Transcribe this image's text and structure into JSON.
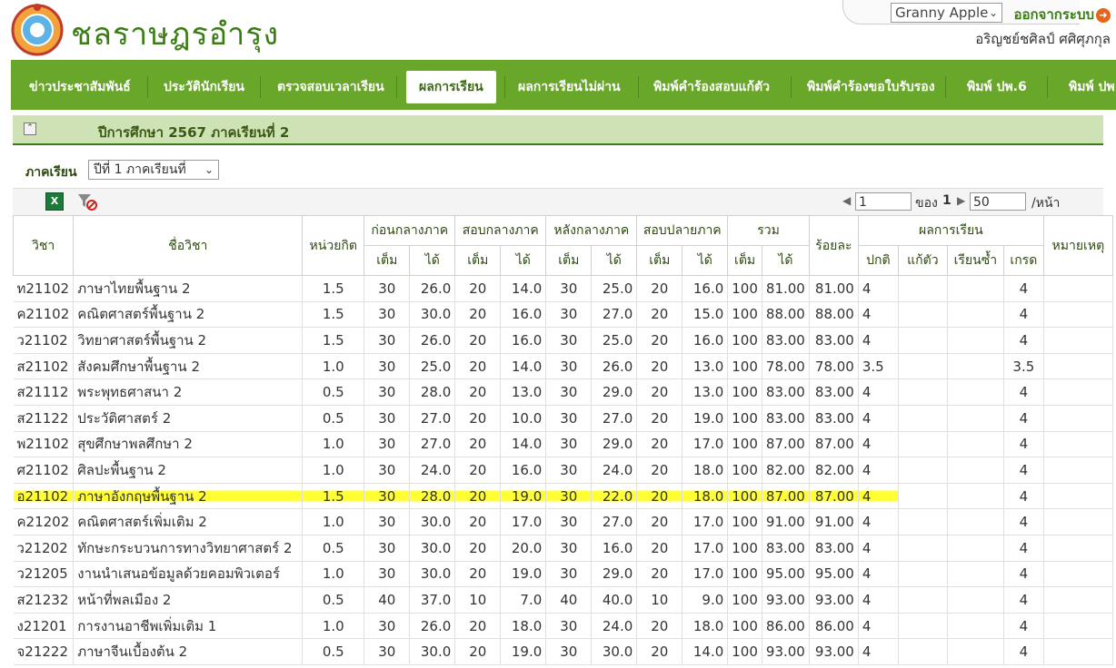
{
  "header": {
    "school_name": "ชลราษฎรอำรุง",
    "user_select_value": "Granny Apple",
    "logout_label": "ออกจากระบบ",
    "user_fullname": "อริญชย์ชศิลป์  ศศิศุภกุล"
  },
  "nav": {
    "items": [
      "ข่าวประชาสัมพันธ์",
      "ประวัตินักเรียน",
      "ตรวจสอบเวลาเรียน",
      "ผลการเรียน",
      "ผลการเรียนไม่ผ่าน",
      "พิมพ์คำร้องสอบแก้ตัว",
      "พิมพ์คำร้องขอใบรับรอง",
      "พิมพ์ ปพ.6",
      "พิมพ์ ปพ"
    ],
    "active_index": 3
  },
  "section": {
    "title": "ปีการศึกษา  2567  ภาคเรียนที่  2"
  },
  "filter": {
    "term_label": "ภาคเรียน",
    "term_value": "ปีที่  1  ภาคเรียนที่"
  },
  "pager": {
    "page": "1",
    "of_label": "ของ",
    "total_pages": "1",
    "per_page": "50",
    "per_page_suffix": "/หน้า"
  },
  "table": {
    "headers": {
      "subject_code": "วิชา",
      "subject_name": "ชื่อวิชา",
      "credits": "หน่วยกิต",
      "before_mid": "ก่อนกลางภาค",
      "midterm": "สอบกลางภาค",
      "after_mid": "หลังกลางภาค",
      "final": "สอบปลายภาค",
      "total": "รวม",
      "percent": "ร้อยละ",
      "result": "ผลการเรียน",
      "remark": "หมายเหตุ",
      "full": "เต็ม",
      "got": "ได้",
      "normal": "ปกติ",
      "retest": "แก้ตัว",
      "repeat": "เรียนซ้ำ",
      "grade": "เกรด"
    },
    "rows": [
      [
        "ท21102",
        "ภาษาไทยพื้นฐาน  2",
        "1.5",
        "30",
        "26.0",
        "20",
        "14.0",
        "30",
        "25.0",
        "20",
        "16.0",
        "100",
        "81.00",
        "81.00",
        "4",
        "",
        "",
        "4",
        ""
      ],
      [
        "ค21102",
        "คณิตศาสตร์พื้นฐาน  2",
        "1.5",
        "30",
        "30.0",
        "20",
        "16.0",
        "30",
        "27.0",
        "20",
        "15.0",
        "100",
        "88.00",
        "88.00",
        "4",
        "",
        "",
        "4",
        ""
      ],
      [
        "ว21102",
        "วิทยาศาสตร์พื้นฐาน  2",
        "1.5",
        "30",
        "26.0",
        "20",
        "16.0",
        "30",
        "25.0",
        "20",
        "16.0",
        "100",
        "83.00",
        "83.00",
        "4",
        "",
        "",
        "4",
        ""
      ],
      [
        "ส21102",
        "สังคมศึกษาพื้นฐาน  2",
        "1.0",
        "30",
        "25.0",
        "20",
        "14.0",
        "30",
        "26.0",
        "20",
        "13.0",
        "100",
        "78.00",
        "78.00",
        "3.5",
        "",
        "",
        "3.5",
        ""
      ],
      [
        "ส21112",
        "พระพุทธศาสนา  2",
        "0.5",
        "30",
        "28.0",
        "20",
        "13.0",
        "30",
        "29.0",
        "20",
        "13.0",
        "100",
        "83.00",
        "83.00",
        "4",
        "",
        "",
        "4",
        ""
      ],
      [
        "ส21122",
        "ประวัติศาสตร์  2",
        "0.5",
        "30",
        "27.0",
        "20",
        "10.0",
        "30",
        "27.0",
        "20",
        "19.0",
        "100",
        "83.00",
        "83.00",
        "4",
        "",
        "",
        "4",
        ""
      ],
      [
        "พ21102",
        "สุขศึกษาพลศึกษา  2",
        "1.0",
        "30",
        "27.0",
        "20",
        "14.0",
        "30",
        "29.0",
        "20",
        "17.0",
        "100",
        "87.00",
        "87.00",
        "4",
        "",
        "",
        "4",
        ""
      ],
      [
        "ศ21102",
        "ศิลปะพื้นฐาน  2",
        "1.0",
        "30",
        "24.0",
        "20",
        "16.0",
        "30",
        "24.0",
        "20",
        "18.0",
        "100",
        "82.00",
        "82.00",
        "4",
        "",
        "",
        "4",
        ""
      ],
      [
        "อ21102",
        "ภาษาอังกฤษพื้นฐาน  2",
        "1.5",
        "30",
        "28.0",
        "20",
        "19.0",
        "30",
        "22.0",
        "20",
        "18.0",
        "100",
        "87.00",
        "87.00",
        "4",
        "",
        "",
        "4",
        ""
      ],
      [
        "ค21202",
        "คณิตศาสตร์เพิ่มเติม  2",
        "1.0",
        "30",
        "30.0",
        "20",
        "17.0",
        "30",
        "27.0",
        "20",
        "17.0",
        "100",
        "91.00",
        "91.00",
        "4",
        "",
        "",
        "4",
        ""
      ],
      [
        "ว21202",
        "ทักษะกระบวนการทางวิทยาศาสตร์  2",
        "0.5",
        "30",
        "30.0",
        "20",
        "20.0",
        "30",
        "16.0",
        "20",
        "17.0",
        "100",
        "83.00",
        "83.00",
        "4",
        "",
        "",
        "4",
        ""
      ],
      [
        "ว21205",
        "งานนำเสนอข้อมูลด้วยคอมพิวเตอร์",
        "1.0",
        "30",
        "30.0",
        "20",
        "19.0",
        "30",
        "29.0",
        "20",
        "17.0",
        "100",
        "95.00",
        "95.00",
        "4",
        "",
        "",
        "4",
        ""
      ],
      [
        "ส21232",
        "หน้าที่พลเมือง  2",
        "0.5",
        "40",
        "37.0",
        "10",
        "7.0",
        "40",
        "40.0",
        "10",
        "9.0",
        "100",
        "93.00",
        "93.00",
        "4",
        "",
        "",
        "4",
        ""
      ],
      [
        "ง21201",
        "การงานอาชีพเพิ่มเติม  1",
        "1.0",
        "30",
        "26.0",
        "20",
        "18.0",
        "30",
        "24.0",
        "20",
        "18.0",
        "100",
        "86.00",
        "86.00",
        "4",
        "",
        "",
        "4",
        ""
      ],
      [
        "จ21222",
        "ภาษาจีนเบื้องต้น  2",
        "0.5",
        "30",
        "30.0",
        "20",
        "19.0",
        "30",
        "30.0",
        "20",
        "14.0",
        "100",
        "93.00",
        "93.00",
        "4",
        "",
        "",
        "4",
        ""
      ]
    ],
    "highlight_row": 8
  }
}
